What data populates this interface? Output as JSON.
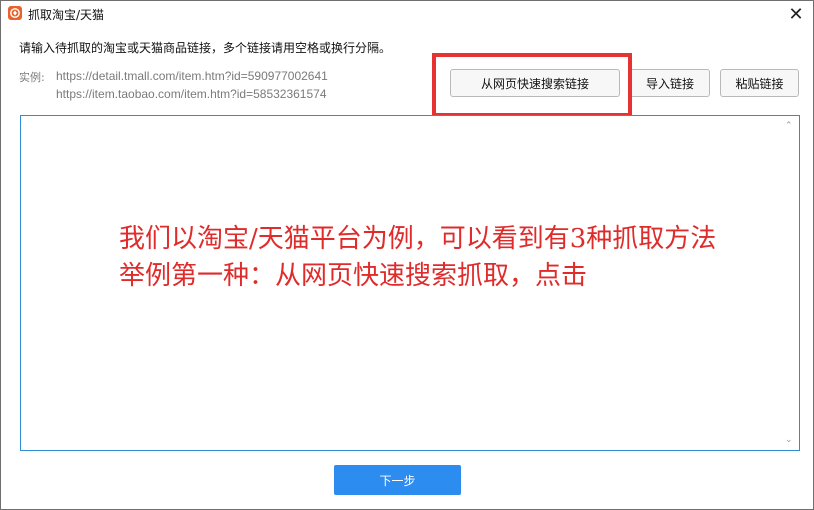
{
  "window": {
    "title": "抓取淘宝/天猫",
    "close_symbol": "✕"
  },
  "instruction": "请输入待抓取的淘宝或天猫商品链接，多个链接请用空格或换行分隔。",
  "examples": {
    "label": "实例:",
    "lines": [
      "https://detail.tmall.com/item.htm?id=590977002641",
      "https://item.taobao.com/item.htm?id=58532361574"
    ]
  },
  "buttons": {
    "search_from_web": "从网页快速搜索链接",
    "import_links": "导入链接",
    "paste_links": "粘贴链接",
    "next": "下一步"
  },
  "link_input": {
    "value": ""
  },
  "annotation": {
    "line1": "我们以淘宝/天猫平台为例，可以看到有3种抓取方法",
    "line2": "举例第一种：从网页快速搜索抓取，点击"
  },
  "colors": {
    "accent": "#2d8cf0",
    "highlight": "#e53333",
    "annotation_text": "#e02b2b",
    "app_icon": "#e8622b"
  },
  "icons": {
    "app": "app-logo-icon",
    "close": "close-icon",
    "scroll_up": "chevron-up-icon",
    "scroll_down": "chevron-down-icon"
  }
}
